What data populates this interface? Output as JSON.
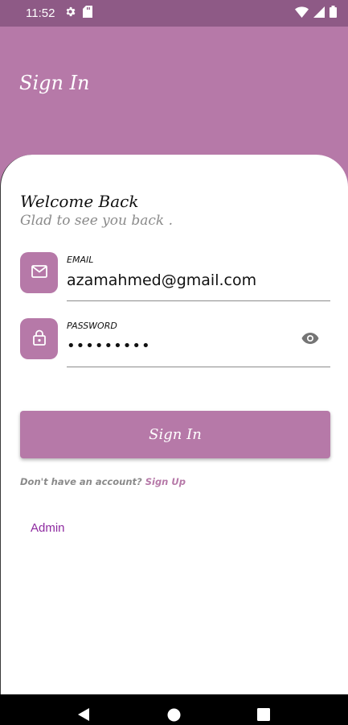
{
  "status_bar": {
    "time": "11:52",
    "icons": [
      "gear-icon",
      "sd-card-icon",
      "wifi-icon",
      "signal-icon",
      "battery-icon"
    ]
  },
  "header": {
    "title": "Sign In"
  },
  "welcome": {
    "title": "Welcome Back",
    "subtitle": "Glad to see you back ."
  },
  "email": {
    "label": "EMAIL",
    "value": "azamahmed@gmail.com",
    "icon": "mail-icon"
  },
  "password": {
    "label": "PASSWORD",
    "value": "•••••••••",
    "icon": "lock-icon",
    "toggle_icon": "eye-icon"
  },
  "signin_button": {
    "label": "Sign In"
  },
  "signup": {
    "question": "Don't have an account?",
    "link": "Sign Up"
  },
  "admin": {
    "label": "Admin"
  },
  "nav": {
    "icons": [
      "back-icon",
      "home-icon",
      "recents-icon"
    ]
  },
  "colors": {
    "primary": "#b679a8",
    "status_bar": "#8e5a86",
    "admin_link": "#8e2aa0"
  }
}
